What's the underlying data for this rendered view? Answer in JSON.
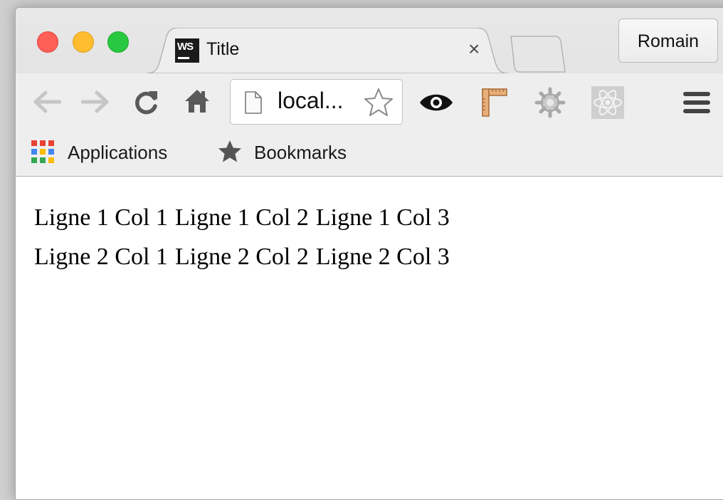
{
  "tab": {
    "favicon_text": "WS",
    "title": "Title",
    "close_glyph": "×"
  },
  "profile": {
    "name": "Romain"
  },
  "address_bar": {
    "url_display": "local..."
  },
  "toolbar": {
    "icons": [
      "back-arrow-icon",
      "forward-arrow-icon",
      "reload-icon",
      "home-icon",
      "eye-icon",
      "ruler-icon",
      "gear-bug-icon",
      "react-atom-icon",
      "hamburger-menu-icon"
    ]
  },
  "bookmarks_bar": {
    "apps_label": "Applications",
    "bookmarks_label": "Bookmarks"
  },
  "table": {
    "rows": [
      [
        "Ligne 1 Col 1",
        "Ligne 1 Col 2",
        "Ligne 1 Col 3"
      ],
      [
        "Ligne 2 Col 1",
        "Ligne 2 Col 2",
        "Ligne 2 Col 3"
      ]
    ]
  },
  "colors": {
    "close": "#fe5f57",
    "minimize": "#febc2e",
    "maximize": "#28c840",
    "apps_grid": [
      "#e94235",
      "#fbbc05",
      "#4285f4",
      "#34a853"
    ]
  }
}
